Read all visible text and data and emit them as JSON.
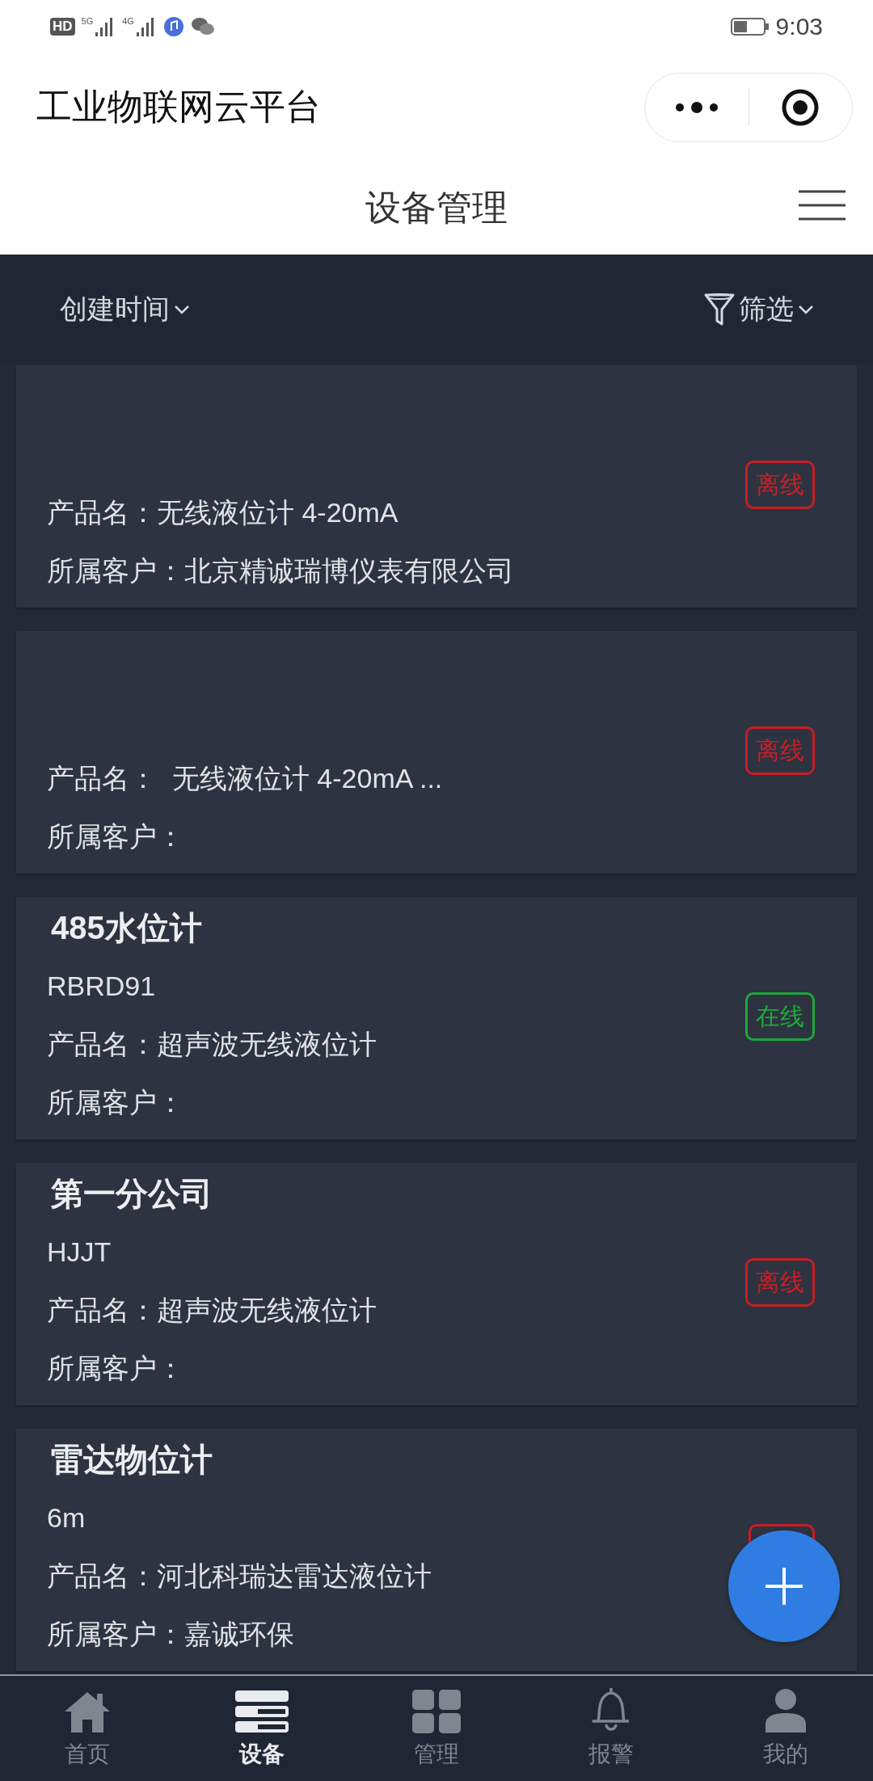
{
  "status_bar": {
    "indicators": [
      "HD",
      "5G",
      "4G"
    ],
    "time": "9:03"
  },
  "header": {
    "title": "工业物联网云平台"
  },
  "page_title": "设备管理",
  "filters": {
    "sort": "创建时间",
    "filter": "筛选"
  },
  "devices": [
    {
      "product": "产品名：无线液位计 4-20mA",
      "customer": "所属客户：北京精诚瑞博仪表有限公司",
      "online": false,
      "status_label": "离线"
    },
    {
      "product": "产品名：  无线液位计 4-20mA ...",
      "customer": "所属客户：",
      "online": false,
      "status_label": "离线"
    },
    {
      "title": "485水位计",
      "code": "RBRD91",
      "product": "产品名：超声波无线液位计",
      "customer": "所属客户：",
      "online": true,
      "status_label": "在线"
    },
    {
      "title": "第一分公司",
      "code": "HJJT",
      "product": "产品名：超声波无线液位计",
      "customer": "所属客户：",
      "online": false,
      "status_label": "离线"
    },
    {
      "title": "雷达物位计",
      "code": "6m",
      "product": "产品名：河北科瑞达雷达液位计",
      "customer": "所属客户：嘉诚环保",
      "online": false
    }
  ],
  "tabs": [
    {
      "label": "首页",
      "selected": false
    },
    {
      "label": "设备",
      "selected": true
    },
    {
      "label": "管理",
      "selected": false
    },
    {
      "label": "报警",
      "selected": false
    },
    {
      "label": "我的",
      "selected": false
    }
  ]
}
